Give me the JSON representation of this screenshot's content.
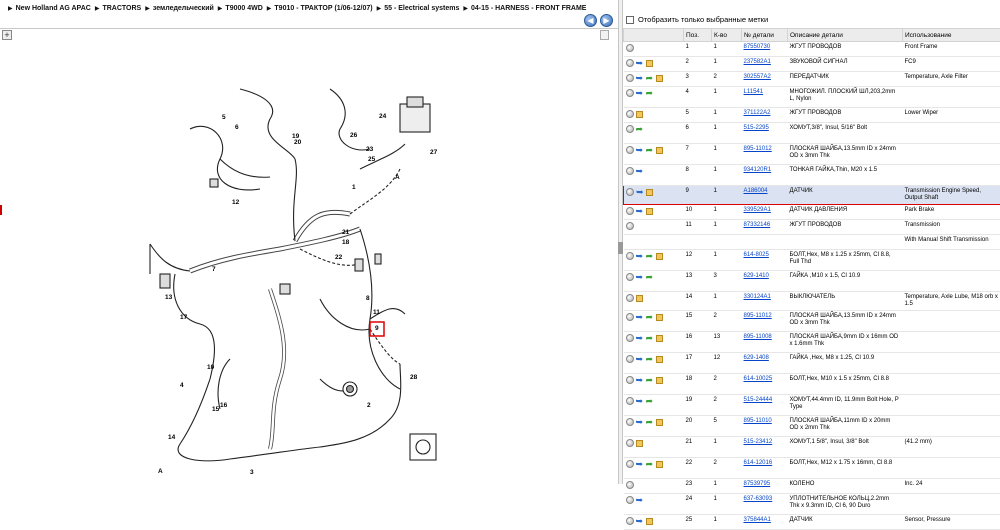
{
  "breadcrumb": [
    "New Holland AG APAC",
    "TRACTORS",
    "земледельческий",
    "T9000 4WD",
    "T9010 - ТРАКТОР (1/06-12/07)",
    "55 - Electrical systems",
    "04-15 - HARNESS - FRONT FRAME"
  ],
  "nav": {
    "back_icon": "arrow-left-icon",
    "forward_icon": "arrow-right-icon"
  },
  "filter_label": "Отобразить только выбранные метки",
  "columns": [
    "Поз.",
    "К-во",
    "№ детали",
    "Описание детали",
    "Использование"
  ],
  "rows": [
    {
      "pos": "1",
      "qty": "1",
      "part": "87550730",
      "desc": "ЖГУТ ПРОВОДОВ",
      "usage": "Front Frame",
      "icons": [
        "circle"
      ]
    },
    {
      "pos": "2",
      "qty": "1",
      "part": "237582A1",
      "desc": "ЗВУКОВОЙ СИГНАЛ",
      "usage": "FC9",
      "icons": [
        "circle",
        "blue",
        "box"
      ]
    },
    {
      "pos": "3",
      "qty": "2",
      "part": "302557A2",
      "desc": "ПЕРЕДАТЧИК",
      "usage": "Temperature, Axle Filter",
      "icons": [
        "circle",
        "blue",
        "green",
        "box"
      ]
    },
    {
      "pos": "4",
      "qty": "1",
      "part": "L11541",
      "desc": "МНОГОЖИЛ. ПЛОСКИЙ ШЛ,203,2mm L, Nylon",
      "usage": "",
      "icons": [
        "circle",
        "blue",
        "green"
      ]
    },
    {
      "pos": "5",
      "qty": "1",
      "part": "371122A2",
      "desc": "ЖГУТ ПРОВОДОВ",
      "usage": "Lower Wiper",
      "icons": [
        "circle",
        "box"
      ]
    },
    {
      "pos": "6",
      "qty": "1",
      "part": "515-2295",
      "desc": "ХОМУТ,3/8\", Insul, 5/16\" Bolt",
      "usage": "",
      "icons": [
        "circle",
        "green"
      ]
    },
    {
      "pos": "7",
      "qty": "1",
      "part": "895-11012",
      "desc": "ПЛОСКАЯ ШАЙБА,13.5mm ID x 24mm OD x 3mm Thk",
      "usage": "",
      "icons": [
        "circle",
        "blue",
        "green",
        "box"
      ]
    },
    {
      "pos": "8",
      "qty": "1",
      "part": "934120R1",
      "desc": "ТОНКАЯ ГАЙКА,Thin, M20 x 1.5",
      "usage": "",
      "icons": [
        "circle",
        "blue"
      ]
    },
    {
      "pos": "9",
      "qty": "1",
      "part": "A186004",
      "desc": "ДАТЧИК",
      "usage": "Transmission Engine Speed, Output Shaft",
      "icons": [
        "circle",
        "blue",
        "box"
      ],
      "selected": true
    },
    {
      "pos": "10",
      "qty": "1",
      "part": "339529A1",
      "desc": "ДАТЧИК ДАВЛЕНИЯ",
      "usage": "Park Brake",
      "icons": [
        "circle",
        "blue",
        "box"
      ]
    },
    {
      "pos": "11",
      "qty": "1",
      "part": "87332146",
      "desc": "ЖГУТ ПРОВОДОВ",
      "usage": "Transmission",
      "icons": [
        "circle"
      ]
    },
    {
      "pos": "",
      "qty": "",
      "part": "",
      "desc": "",
      "usage": "With Manual Shift Transmission",
      "icons": []
    },
    {
      "pos": "12",
      "qty": "1",
      "part": "614-8025",
      "desc": "БОЛТ,Hex, M8 x 1.25 x 25mm, Cl 8.8, Full Thd",
      "usage": "",
      "icons": [
        "circle",
        "blue",
        "green",
        "box"
      ]
    },
    {
      "pos": "13",
      "qty": "3",
      "part": "629-1410",
      "desc": "ГАЙКА ,M10 x 1.5, Cl 10.9",
      "usage": "",
      "icons": [
        "circle",
        "blue",
        "green"
      ]
    },
    {
      "pos": "14",
      "qty": "1",
      "part": "330124A1",
      "desc": "ВЫКЛЮЧАТЕЛЬ",
      "usage": "Temperature, Axle Lube, M18 orb x 1.5",
      "icons": [
        "circle",
        "box"
      ]
    },
    {
      "pos": "15",
      "qty": "2",
      "part": "895-11012",
      "desc": "ПЛОСКАЯ ШАЙБА,13.5mm ID x 24mm OD x 3mm Thk",
      "usage": "",
      "icons": [
        "circle",
        "blue",
        "green",
        "box"
      ]
    },
    {
      "pos": "16",
      "qty": "13",
      "part": "895-11008",
      "desc": "ПЛОСКАЯ ШАЙБА,9mm ID x 16mm OD x 1.6mm Thk",
      "usage": "",
      "icons": [
        "circle",
        "blue",
        "green",
        "box"
      ]
    },
    {
      "pos": "17",
      "qty": "12",
      "part": "629-1408",
      "desc": "ГАЙКА ,Hex, M8 x 1.25, Cl 10.9",
      "usage": "",
      "icons": [
        "circle",
        "blue",
        "green",
        "box"
      ]
    },
    {
      "pos": "18",
      "qty": "2",
      "part": "614-10025",
      "desc": "БОЛТ,Hex, M10 x 1.5 x 25mm, Cl 8.8",
      "usage": "",
      "icons": [
        "circle",
        "blue",
        "green",
        "box"
      ]
    },
    {
      "pos": "19",
      "qty": "2",
      "part": "515-24444",
      "desc": "ХОМУТ,44.4mm ID, 11.9mm Bolt Hole, P Type",
      "usage": "",
      "icons": [
        "circle",
        "blue",
        "green"
      ]
    },
    {
      "pos": "20",
      "qty": "5",
      "part": "895-11010",
      "desc": "ПЛОСКАЯ ШАЙБА,11mm ID x 20mm OD x 2mm Thk",
      "usage": "",
      "icons": [
        "circle",
        "blue",
        "green",
        "box"
      ]
    },
    {
      "pos": "21",
      "qty": "1",
      "part": "515-23412",
      "desc": "ХОМУТ,1 5/8\", Insul, 3/8\" Bolt",
      "usage": "(41.2 mm)",
      "icons": [
        "circle",
        "box"
      ]
    },
    {
      "pos": "22",
      "qty": "2",
      "part": "614-12016",
      "desc": "БОЛТ,Hex, M12 x 1.75 x 16mm, Cl 8.8",
      "usage": "",
      "icons": [
        "circle",
        "blue",
        "green",
        "box"
      ]
    },
    {
      "pos": "23",
      "qty": "1",
      "part": "87539795",
      "desc": "КОЛЕНО",
      "usage": "Inc. 24",
      "icons": [
        "circle"
      ]
    },
    {
      "pos": "24",
      "qty": "1",
      "part": "637-63093",
      "desc": "УПЛОТНИТЕЛЬНОЕ КОЛЬЦ,2.2mm Thk x 9.3mm ID, Cl 6, 90 Duro",
      "usage": "",
      "icons": [
        "circle",
        "blue"
      ]
    },
    {
      "pos": "25",
      "qty": "1",
      "part": "375844A1",
      "desc": "ДАТЧИК",
      "usage": "Sensor, Pressure",
      "icons": [
        "circle",
        "blue",
        "box"
      ]
    }
  ],
  "diagram": {
    "labels": [
      "1",
      "2",
      "3",
      "4",
      "5",
      "6",
      "7",
      "8",
      "9",
      "10",
      "11",
      "12",
      "13",
      "14",
      "15",
      "16",
      "17",
      "18",
      "19",
      "20",
      "21",
      "22",
      "23",
      "24",
      "25",
      "26",
      "27",
      "28",
      "A",
      "A"
    ],
    "highlighted": "9"
  }
}
